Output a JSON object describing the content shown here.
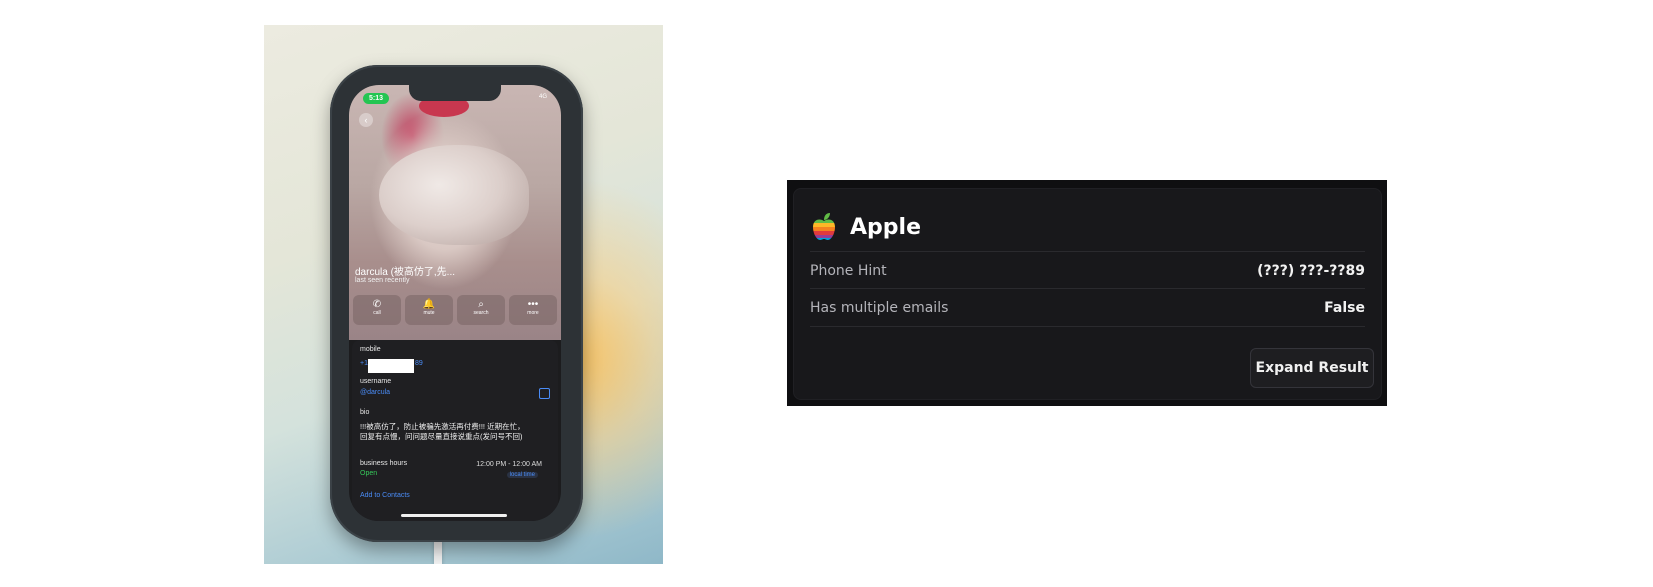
{
  "photo": {
    "status_time": "5:13",
    "status_network": "4G",
    "contact_name": "darcula (被高仿了,先...",
    "contact_status": "last seen recently",
    "actions": [
      {
        "label": "call",
        "icon": "phone-icon",
        "glyph": "✆"
      },
      {
        "label": "mute",
        "icon": "bell-icon",
        "glyph": "🔔"
      },
      {
        "label": "search",
        "icon": "search-icon",
        "glyph": "⌕"
      },
      {
        "label": "more",
        "icon": "more-icon",
        "glyph": "•••"
      }
    ],
    "mobile_label": "mobile",
    "mobile_prefix": "+1",
    "mobile_suffix": "89",
    "username_label": "username",
    "username_value": "@darcula",
    "bio_label": "bio",
    "bio_text": "!!!被高仿了，防止被骗先激活再付费!!! 近期在忙，回复有点慢，问问题尽量直接说重点(发问号不回)",
    "hours_label": "business hours",
    "hours_status": "Open",
    "hours_value": "12:00 PM - 12:00 AM",
    "hours_tz": "local time",
    "add_contact": "Add to Contacts"
  },
  "result": {
    "title": "Apple",
    "icon": "apple-logo-icon",
    "rows": [
      {
        "key": "Phone Hint",
        "value": "(???) ???-??89"
      },
      {
        "key": "Has multiple emails",
        "value": "False"
      }
    ],
    "expand_label": "Expand Result"
  }
}
